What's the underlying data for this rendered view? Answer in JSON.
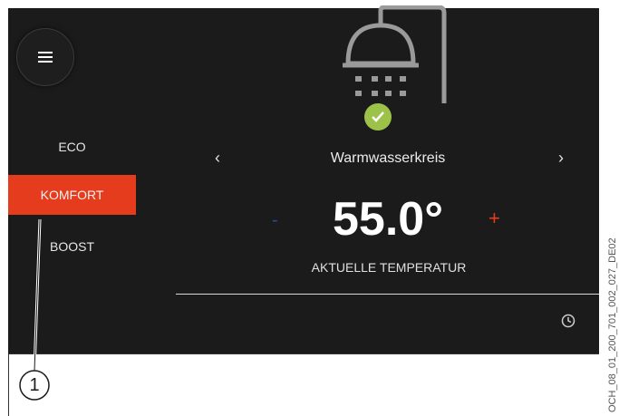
{
  "menu": {
    "icon": "hamburger-icon"
  },
  "modes": {
    "eco": "ECO",
    "komfort": "KOMFORT",
    "boost": "BOOST",
    "active": "KOMFORT"
  },
  "circuit": {
    "name": "Warmwasserkreis",
    "prev_arrow": "‹",
    "next_arrow": "›"
  },
  "temperature": {
    "value": "55.0°",
    "label": "AKTUELLE TEMPERATUR",
    "minus": "-",
    "plus": "+"
  },
  "icons": {
    "main": "shower-icon",
    "status": "check-icon",
    "schedule": "clock-icon"
  },
  "colors": {
    "background": "#1b1b1b",
    "accent": "#e53c1d",
    "ok": "#9cc24a",
    "minus": "#2c4a9a"
  },
  "annotation": {
    "callout_number": "1",
    "document_code": "OCH_08_01_200_701_002_027_DE02"
  }
}
